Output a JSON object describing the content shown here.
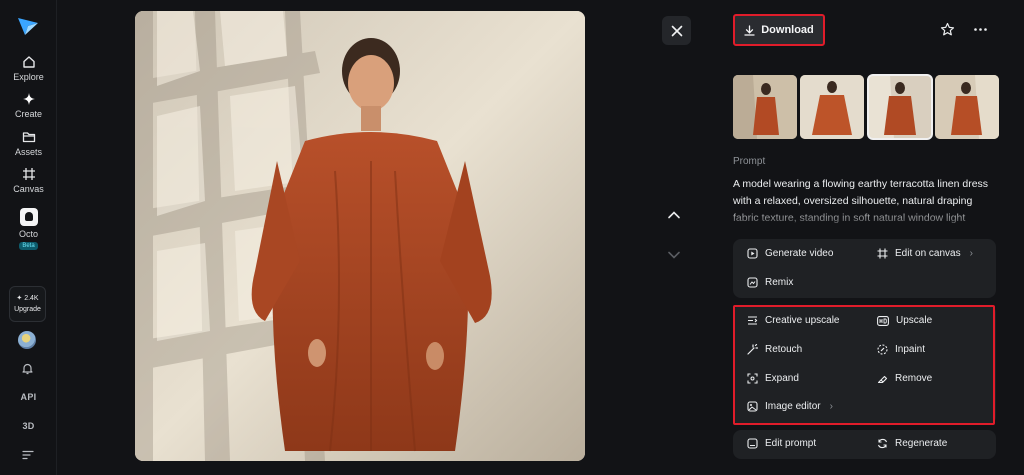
{
  "nav": {
    "items": [
      {
        "label": "Explore",
        "icon": "home-icon"
      },
      {
        "label": "Create",
        "icon": "sparkle-icon"
      },
      {
        "label": "Assets",
        "icon": "folder-icon"
      },
      {
        "label": "Canvas",
        "icon": "canvas-icon"
      },
      {
        "label": "Octo",
        "icon": "octo-icon",
        "badge": "Beta"
      }
    ],
    "upgrade_count": "✦ 2.4K",
    "upgrade_label": "Upgrade",
    "api_label": "API",
    "threed_label": "3D"
  },
  "viewer": {
    "accent_outline": "#e01c2a"
  },
  "panel": {
    "download_label": "Download",
    "thumbnails_count": 4,
    "selected_thumbnail": 3,
    "prompt_label": "Prompt",
    "prompt_text": "A model wearing a flowing earthy terracotta linen dress with a relaxed, oversized silhouette, natural draping fabric texture, standing in soft natural window light against a",
    "actions_primary": {
      "generate_video": "Generate video",
      "edit_on_canvas": "Edit on canvas",
      "remix": "Remix"
    },
    "actions_tools": {
      "creative_upscale": "Creative upscale",
      "upscale": "Upscale",
      "retouch": "Retouch",
      "inpaint": "Inpaint",
      "expand": "Expand",
      "remove": "Remove",
      "image_editor": "Image editor"
    },
    "actions_bottom": {
      "edit_prompt": "Edit prompt",
      "regenerate": "Regenerate"
    }
  }
}
